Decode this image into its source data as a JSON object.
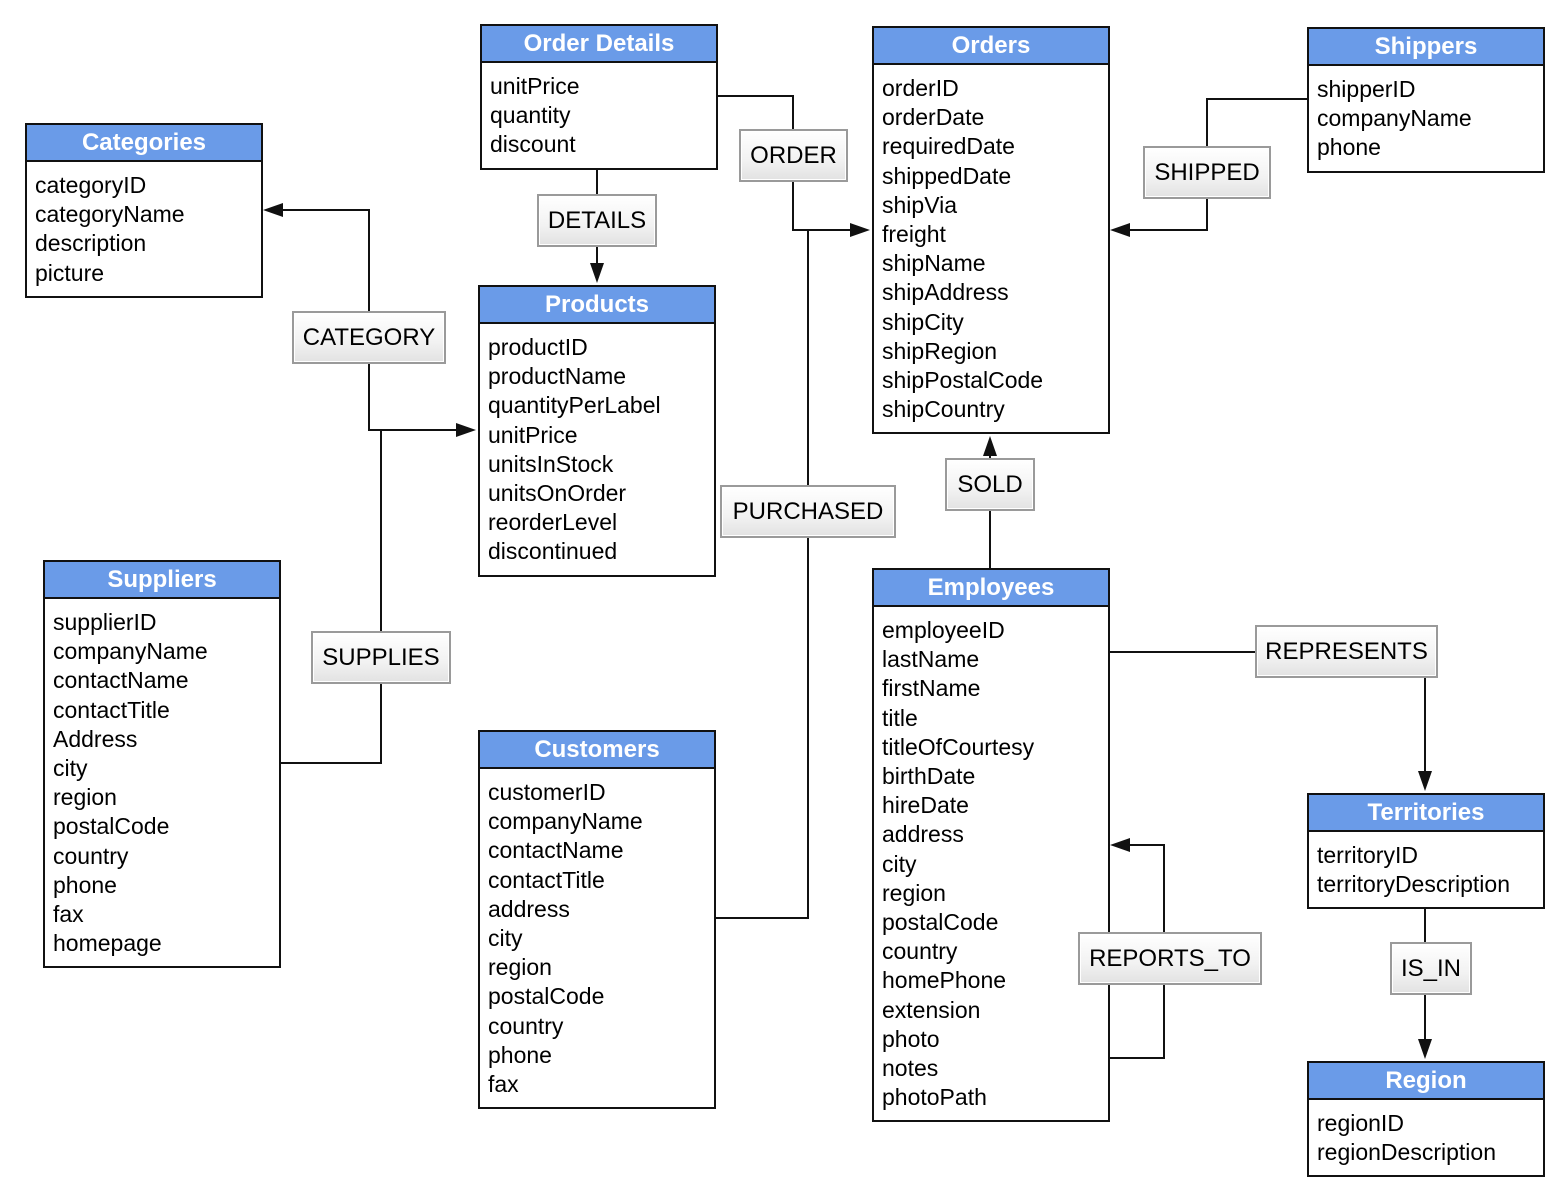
{
  "entities": [
    {
      "name": "Order Details",
      "attributes": [
        "unitPrice",
        "quantity",
        "discount"
      ]
    },
    {
      "name": "Orders",
      "attributes": [
        "orderID",
        "orderDate",
        "requiredDate",
        "shippedDate",
        "shipVia",
        "freight",
        "shipName",
        "shipAddress",
        "shipCity",
        "shipRegion",
        "shipPostalCode",
        "shipCountry"
      ]
    },
    {
      "name": "Shippers",
      "attributes": [
        "shipperID",
        "companyName",
        "phone"
      ]
    },
    {
      "name": "Categories",
      "attributes": [
        "categoryID",
        "categoryName",
        "description",
        "picture"
      ]
    },
    {
      "name": "Products",
      "attributes": [
        "productID",
        "productName",
        "quantityPerLabel",
        "unitPrice",
        "unitsInStock",
        "unitsOnOrder",
        "reorderLevel",
        "discontinued"
      ]
    },
    {
      "name": "Suppliers",
      "attributes": [
        "supplierID",
        "companyName",
        "contactName",
        "contactTitle",
        "Address",
        "city",
        "region",
        "postalCode",
        "country",
        "phone",
        "fax",
        "homepage"
      ]
    },
    {
      "name": "Customers",
      "attributes": [
        "customerID",
        "companyName",
        "contactName",
        "contactTitle",
        "address",
        "city",
        "region",
        "postalCode",
        "country",
        "phone",
        "fax"
      ]
    },
    {
      "name": "Employees",
      "attributes": [
        "employeeID",
        "lastName",
        "firstName",
        "title",
        "titleOfCourtesy",
        "birthDate",
        "hireDate",
        "address",
        "city",
        "region",
        "postalCode",
        "country",
        "homePhone",
        "extension",
        "photo",
        "notes",
        "photoPath"
      ]
    },
    {
      "name": "Territories",
      "attributes": [
        "territoryID",
        "territoryDescription"
      ]
    },
    {
      "name": "Region",
      "attributes": [
        "regionID",
        "regionDescription"
      ]
    }
  ],
  "relationships": [
    {
      "label": "ORDER",
      "from": "Order Details",
      "to": "Orders"
    },
    {
      "label": "DETAILS",
      "from": "Order Details",
      "to": "Products"
    },
    {
      "label": "SHIPPED",
      "from": "Shippers",
      "to": "Orders"
    },
    {
      "label": "CATEGORY",
      "from": "Products",
      "to": "Categories"
    },
    {
      "label": "PURCHASED",
      "from": "Customers",
      "to": "Orders"
    },
    {
      "label": "SOLD",
      "from": "Employees",
      "to": "Orders"
    },
    {
      "label": "SUPPLIES",
      "from": "Suppliers",
      "to": "Products"
    },
    {
      "label": "REPRESENTS",
      "from": "Employees",
      "to": "Territories"
    },
    {
      "label": "REPORTS_TO",
      "from": "Employees",
      "to": "Employees"
    },
    {
      "label": "IS_IN",
      "from": "Territories",
      "to": "Region"
    }
  ],
  "colors": {
    "entity_header": "#6a9be8",
    "line": "#111111"
  }
}
